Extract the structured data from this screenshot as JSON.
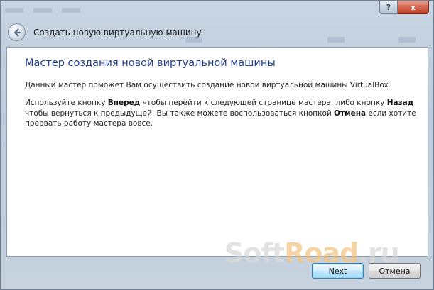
{
  "window": {
    "help_label": "?",
    "close_label": "x"
  },
  "header": {
    "title": "Создать новую виртуальную машину",
    "back_icon": "back-arrow-icon"
  },
  "wizard": {
    "heading": "Мастер создания новой виртуальной машины",
    "intro": "Данный мастер поможет Вам осуществить создание новой виртуальной машины VirtualBox.",
    "instr": {
      "t1": "Используйте кнопку ",
      "b1": "Вперед",
      "t2": " чтобы перейти к следующей странице мастера, либо кнопку ",
      "b2": "Назад",
      "t3": " чтобы вернуться к предыдущей. Вы также можете воспользоваться кнопкой ",
      "b3": "Отмена",
      "t4": " если хотите прервать работу мастера вовсе."
    }
  },
  "footer": {
    "watermark_soft": "Soft",
    "watermark_road": "Road",
    "watermark_tail": ".ru",
    "next_label": "Next",
    "cancel_label": "Отмена"
  },
  "colors": {
    "heading": "#1e3e8c",
    "close_button": "#c2412a",
    "default_button_border": "#3c7fb1"
  }
}
